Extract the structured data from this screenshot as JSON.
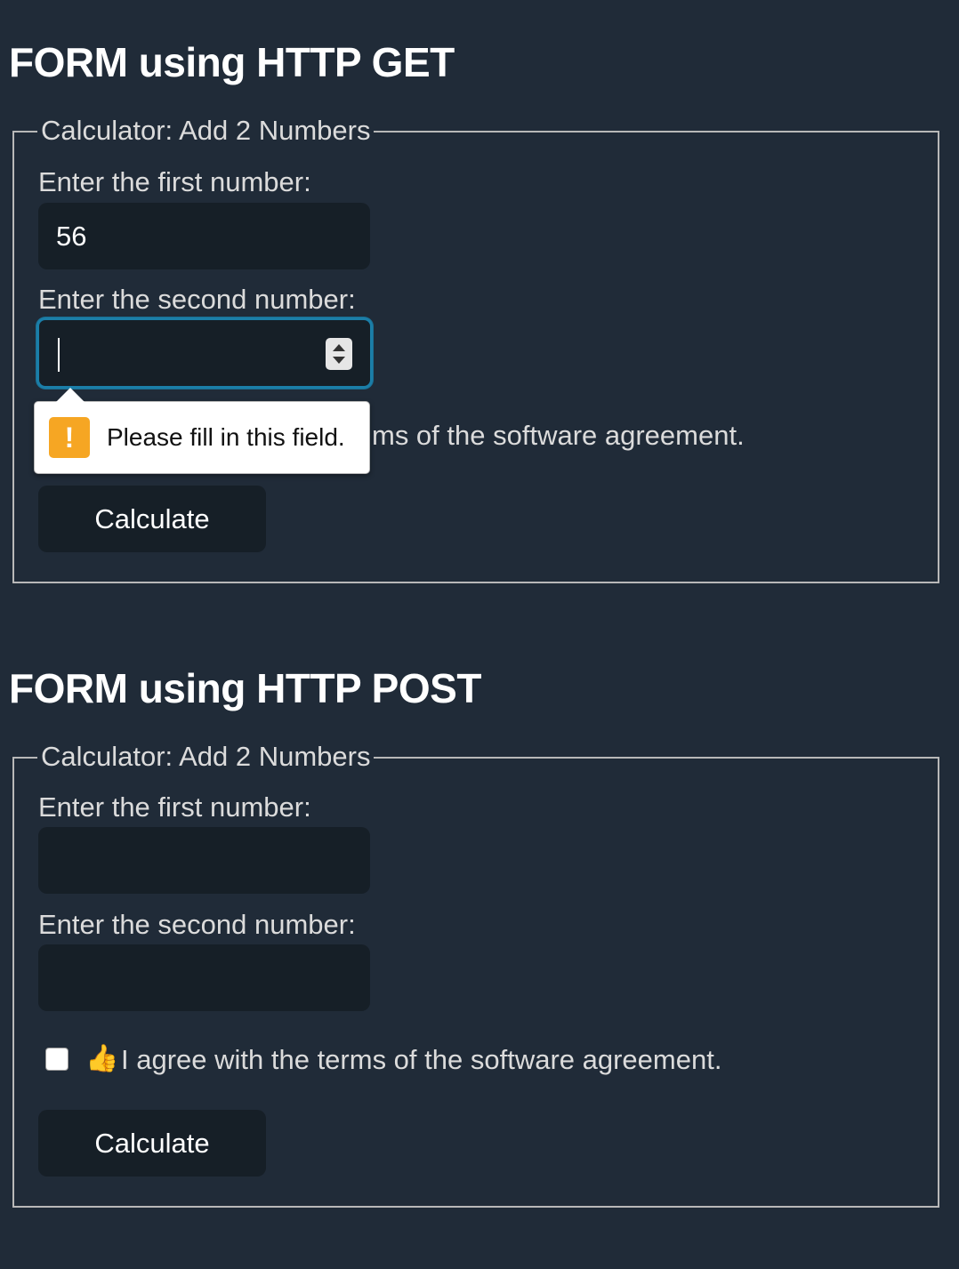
{
  "get_form": {
    "heading": "FORM using HTTP GET",
    "legend": "Calculator: Add 2 Numbers",
    "first_label": "Enter the first number:",
    "first_value": "56",
    "second_label": "Enter the second number:",
    "second_value": "",
    "agree_text_visible": "ms of the software agreement.",
    "button_label": "Calculate"
  },
  "validation_tooltip": {
    "icon": "warning-icon",
    "icon_glyph": "!",
    "message": "Please fill in this field."
  },
  "post_form": {
    "heading": "FORM using HTTP POST",
    "legend": "Calculator: Add 2 Numbers",
    "first_label": "Enter the first number:",
    "first_value": "",
    "second_label": "Enter the second number:",
    "second_value": "",
    "agree_icon": "thumbs-up-icon",
    "agree_text": "I agree with the terms of the software agreement.",
    "agree_checked": false,
    "button_label": "Calculate"
  },
  "colors": {
    "background": "#202b38",
    "input_background": "#161f27",
    "focus_border": "#1b7ea8",
    "warning": "#f6a623"
  }
}
